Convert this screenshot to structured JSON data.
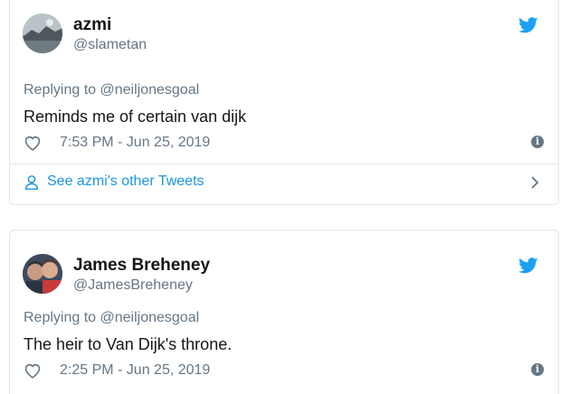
{
  "tweets": [
    {
      "name": "azmi",
      "handle": "@slametan",
      "replying_to": "Replying to @neiljonesgoal",
      "text": "Reminds me of certain van dijk",
      "timestamp": "7:53 PM - Jun 25, 2019",
      "see_more": "See azmi's other Tweets",
      "icons": [
        "twitter-bird-icon",
        "heart-icon",
        "info-icon",
        "person-icon",
        "chevron-right-icon"
      ]
    },
    {
      "name": "James Breheney",
      "handle": "@JamesBreheney",
      "replying_to": "Replying to @neiljonesgoal",
      "text": "The heir to Van Dijk's throne.",
      "timestamp": "2:25 PM - Jun 25, 2019",
      "icons": [
        "twitter-bird-icon",
        "heart-icon",
        "info-icon"
      ]
    }
  ],
  "colors": {
    "twitter_blue": "#1da1f2",
    "link_blue": "#1b95e0",
    "secondary_text": "#657786",
    "border": "#e1e8ed"
  }
}
